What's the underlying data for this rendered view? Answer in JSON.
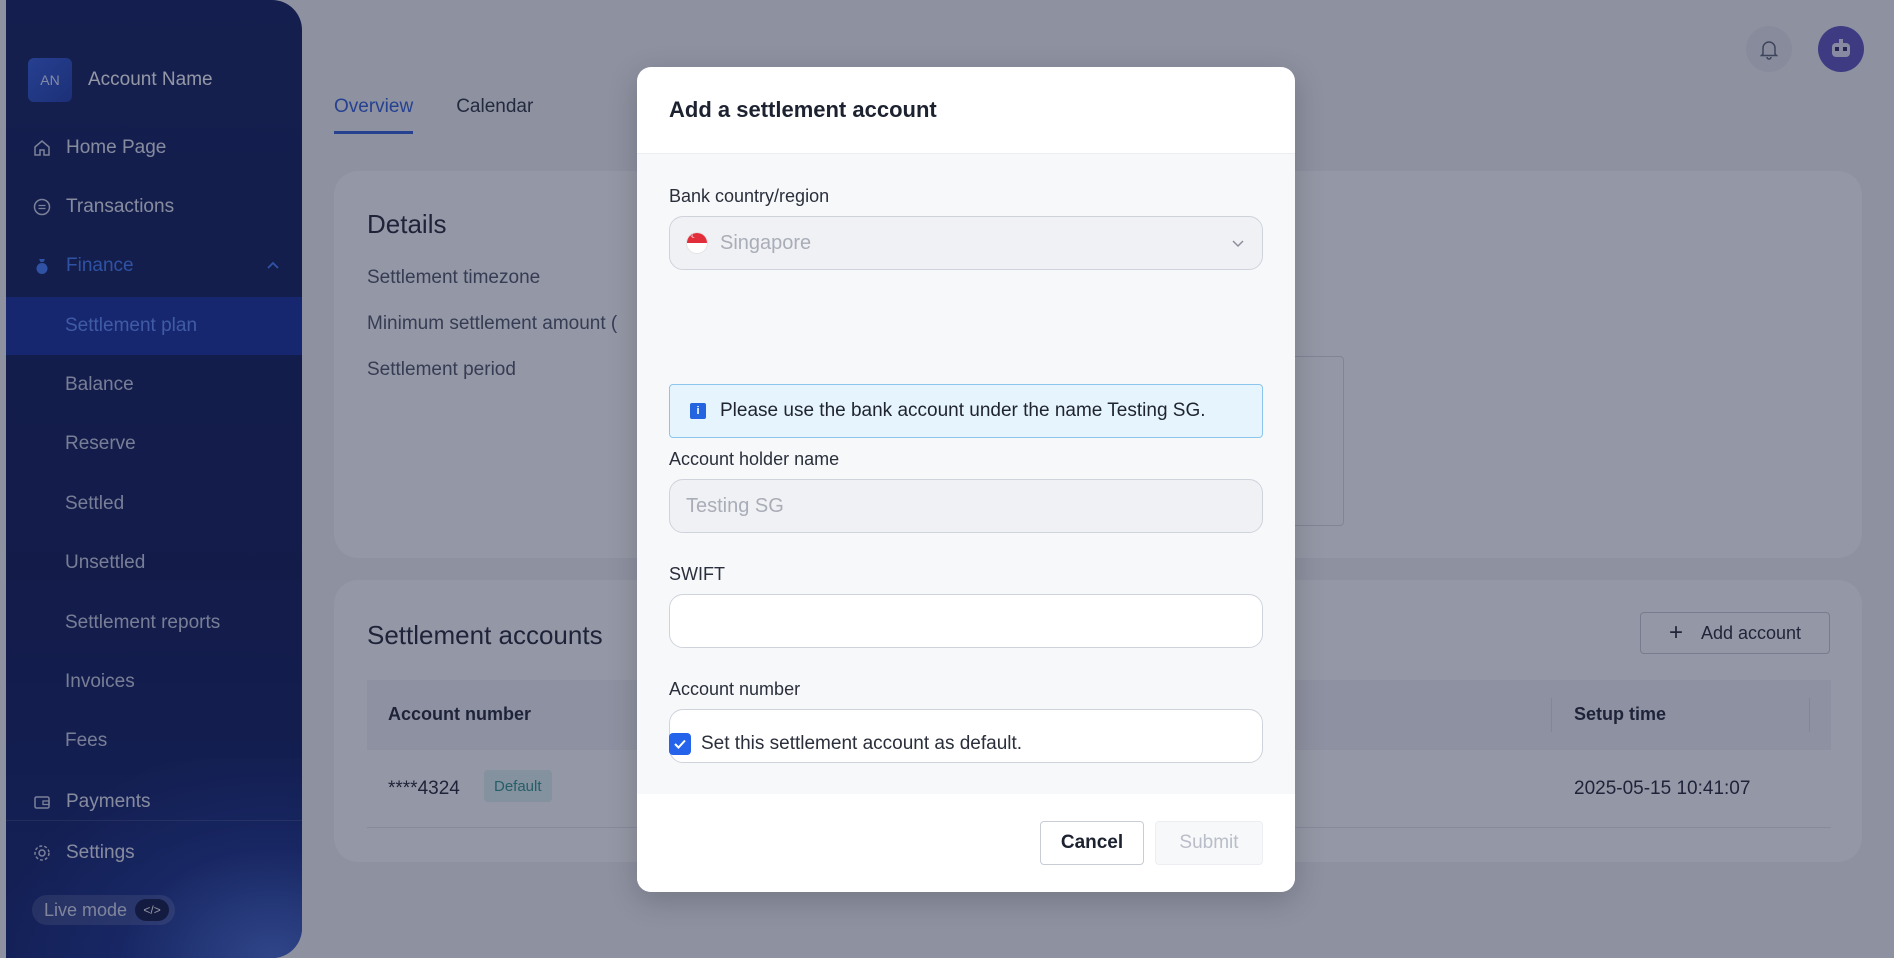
{
  "sidebar": {
    "account_initials": "AN",
    "account_name": "Account Name",
    "nav": {
      "home": "Home Page",
      "transactions": "Transactions",
      "finance": "Finance",
      "payments": "Payments",
      "settings": "Settings"
    },
    "finance_items": [
      "Settlement plan",
      "Balance",
      "Reserve",
      "Settled",
      "Unsettled",
      "Settlement reports",
      "Invoices",
      "Fees"
    ],
    "live_mode": "Live mode",
    "live_code": "</>"
  },
  "tabs": [
    "Overview",
    "Calendar"
  ],
  "details": {
    "title": "Details",
    "rows": [
      "Settlement timezone",
      "Minimum settlement amount (",
      "Settlement period"
    ]
  },
  "settlement_accounts": {
    "title": "Settlement accounts",
    "add_button": "Add account",
    "columns": [
      "Account number",
      "Setup time"
    ],
    "rows": [
      {
        "account_number": "****4324",
        "badge": "Default",
        "setup_time": "2025-05-15 10:41:07"
      }
    ]
  },
  "modal": {
    "title": "Add a settlement account",
    "country_label": "Bank country/region",
    "country_value": "Singapore",
    "info_text": "Please use the bank account under the name Testing SG.",
    "holder_label": "Account holder name",
    "holder_value": "Testing SG",
    "swift_label": "SWIFT",
    "swift_value": "",
    "account_label": "Account number",
    "account_value": "",
    "default_checkbox": "Set this settlement account as default.",
    "default_checked": true,
    "cancel": "Cancel",
    "submit": "Submit"
  },
  "colors": {
    "primary": "#2563eb",
    "sidebar_bg": "#0b1a5a",
    "badge_text": "#2a948c"
  }
}
